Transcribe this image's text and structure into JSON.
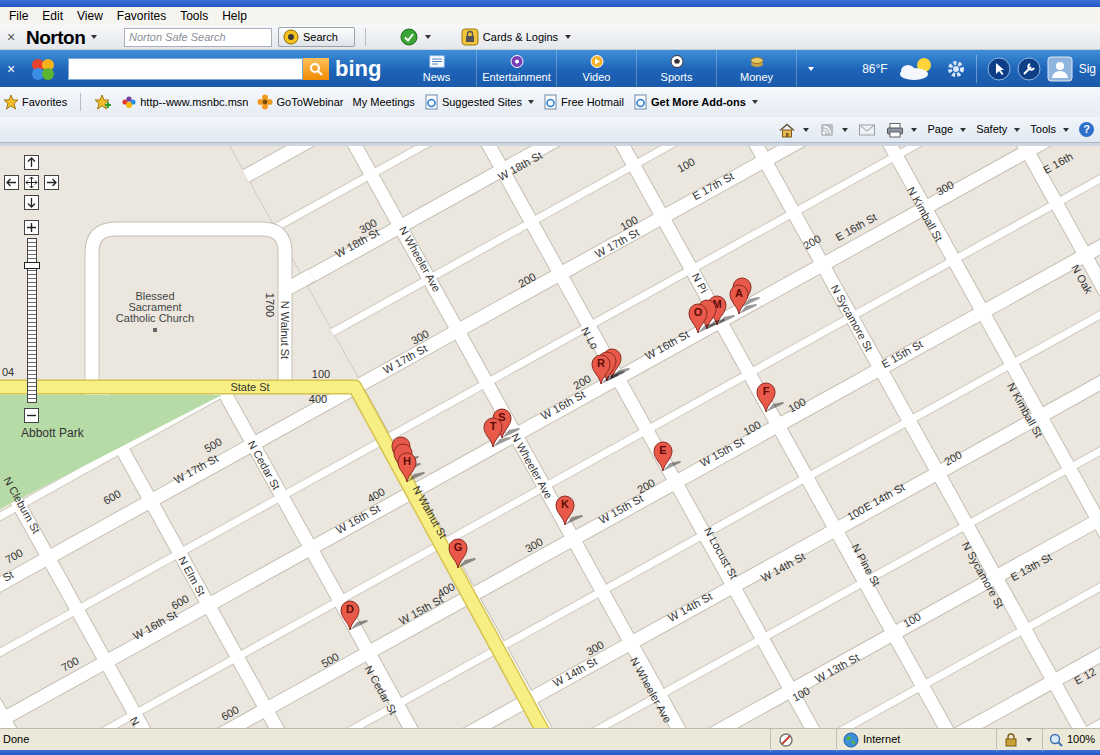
{
  "menu_bar": {
    "items": [
      "File",
      "Edit",
      "View",
      "Favorites",
      "Tools",
      "Help"
    ]
  },
  "norton_toolbar": {
    "close": "×",
    "logo": "Norton",
    "search": {
      "placeholder": "Norton Safe Search"
    },
    "search_button": "Search",
    "cards_logins": "Cards & Logins"
  },
  "bing_bar": {
    "close": "×",
    "logo": "bing",
    "buttons": [
      {
        "label": "News"
      },
      {
        "label": "Entertainment"
      },
      {
        "label": "Video"
      },
      {
        "label": "Sports"
      },
      {
        "label": "Money"
      }
    ],
    "temperature": "86°F",
    "sign_in": "Sig"
  },
  "favorites_bar": {
    "label": "Favorites",
    "links": [
      {
        "label": "http--www.msnbc.msn",
        "kind": "msnbc"
      },
      {
        "label": "GoToWebinar",
        "kind": "webinar"
      },
      {
        "label": "My Meetings",
        "kind": "plain"
      },
      {
        "label": "Suggested Sites",
        "kind": "ie-menu"
      },
      {
        "label": "Free Hotmail",
        "kind": "ie"
      },
      {
        "label": "Get More Add-ons",
        "kind": "ie-menu-strong"
      }
    ]
  },
  "command_bar": {
    "items": [
      {
        "label": "Page"
      },
      {
        "label": "Safety"
      },
      {
        "label": "Tools"
      }
    ],
    "help": "?"
  },
  "map": {
    "zoom": {
      "level": 0.85
    },
    "places": [
      {
        "text": "Blessed Sacrament Catholic Church"
      },
      {
        "text": "Abbott Park"
      }
    ],
    "streets": [
      {
        "text": "W 18th St"
      },
      {
        "text": "W 18th St"
      },
      {
        "text": "300"
      },
      {
        "text": "W 17th St"
      },
      {
        "text": "100"
      },
      {
        "text": "E 17th St"
      },
      {
        "text": "100"
      },
      {
        "text": "N Wheeler Ave"
      },
      {
        "text": "N Walnut St"
      },
      {
        "text": "1700"
      },
      {
        "text": "State St"
      },
      {
        "text": "100"
      },
      {
        "text": "400"
      },
      {
        "text": "W 17th St"
      },
      {
        "text": "300"
      },
      {
        "text": "200"
      },
      {
        "text": "N Lo"
      },
      {
        "text": "N Pi"
      },
      {
        "text": "W 16th St"
      },
      {
        "text": "200"
      },
      {
        "text": "W 16th St"
      },
      {
        "text": "N Sycamore St"
      },
      {
        "text": "E 16th St"
      },
      {
        "text": "200"
      },
      {
        "text": "N Kimball St"
      },
      {
        "text": "300"
      },
      {
        "text": "E 16th"
      },
      {
        "text": "E 15th St"
      },
      {
        "text": "N Kimball St"
      },
      {
        "text": "N Oak"
      },
      {
        "text": "100"
      },
      {
        "text": "100"
      },
      {
        "text": "W 15th St"
      },
      {
        "text": "200"
      },
      {
        "text": "W 15th St"
      },
      {
        "text": "300"
      },
      {
        "text": "N Wheeler Ave"
      },
      {
        "text": "W 16th St"
      },
      {
        "text": "400"
      },
      {
        "text": "N Cedar St"
      },
      {
        "text": "W 17th St"
      },
      {
        "text": "500"
      },
      {
        "text": "600"
      },
      {
        "text": "N Cleburn St"
      },
      {
        "text": "N Walnut St"
      },
      {
        "text": "W 15th St"
      },
      {
        "text": "400"
      },
      {
        "text": "N Elm St"
      },
      {
        "text": "W 16th St"
      },
      {
        "text": "600"
      },
      {
        "text": "700"
      },
      {
        "text": "700"
      },
      {
        "text": "500"
      },
      {
        "text": "N Cedar St"
      },
      {
        "text": "600"
      },
      {
        "text": "W 14th St"
      },
      {
        "text": "300"
      },
      {
        "text": "N Wheeler Ave"
      },
      {
        "text": "W 14th St"
      },
      {
        "text": "N Locust St"
      },
      {
        "text": "W 14th St"
      },
      {
        "text": "N Pine St"
      },
      {
        "text": "100"
      },
      {
        "text": "E 14th St"
      },
      {
        "text": "200"
      },
      {
        "text": "N Sycamore St"
      },
      {
        "text": "100"
      },
      {
        "text": "E 13th St"
      },
      {
        "text": "W 13th St"
      },
      {
        "text": "100"
      },
      {
        "text": "E 12"
      },
      {
        "text": "04"
      },
      {
        "text": "St"
      },
      {
        "text": "N"
      }
    ],
    "pins": [
      {
        "label": ""
      },
      {
        "label": "A"
      },
      {
        "label": "M"
      },
      {
        "label": ""
      },
      {
        "label": "O"
      },
      {
        "label": ""
      },
      {
        "label": ""
      },
      {
        "label": "R"
      },
      {
        "label": "S"
      },
      {
        "label": "T"
      },
      {
        "label": ""
      },
      {
        "label": ""
      },
      {
        "label": "H"
      },
      {
        "label": "E"
      },
      {
        "label": "F"
      },
      {
        "label": "K"
      },
      {
        "label": "G"
      },
      {
        "label": "D"
      }
    ]
  },
  "status_bar": {
    "text": "Done",
    "zone": "Internet",
    "zoom": "100%"
  }
}
